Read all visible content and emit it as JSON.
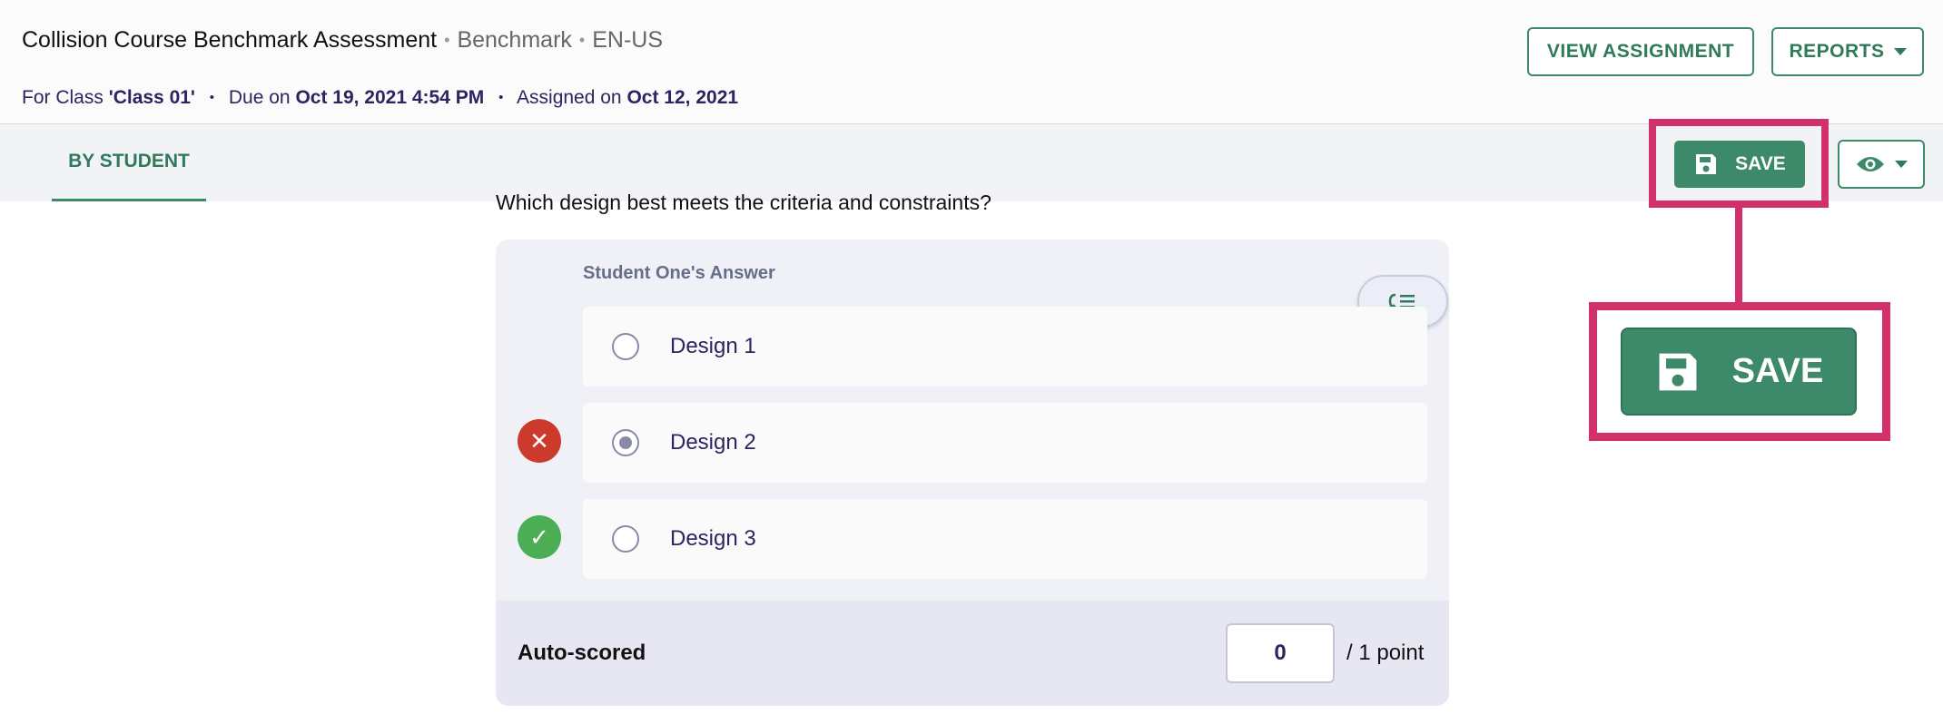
{
  "header": {
    "title": "Collision Course Benchmark Assessment",
    "sep": "•",
    "type": "Benchmark",
    "locale": "EN-US",
    "class_prefix": "For Class",
    "class_name": "'Class 01'",
    "due_prefix": "Due on",
    "due_date": "Oct 19, 2021 4:54 PM",
    "assigned_prefix": "Assigned on",
    "assigned_date": "Oct 12, 2021",
    "view_assignment_label": "VIEW ASSIGNMENT",
    "reports_label": "REPORTS"
  },
  "tabs": [
    {
      "label": "BY STUDENT",
      "active": true
    }
  ],
  "toolbar": {
    "save_label": "SAVE",
    "visibility_icon": "eye-icon"
  },
  "callout": {
    "save_label": "SAVE",
    "highlight_color": "#d1306a"
  },
  "question": {
    "text": "Which design best meets the criteria and constraints?",
    "answer_label": "Student One's Answer",
    "options": [
      {
        "label": "Design 1",
        "selected": false,
        "mark": "none"
      },
      {
        "label": "Design 2",
        "selected": true,
        "mark": "incorrect"
      },
      {
        "label": "Design 3",
        "selected": false,
        "mark": "correct"
      }
    ]
  },
  "scoring": {
    "label": "Auto-scored",
    "value": "0",
    "max_label": "/ 1 point"
  },
  "colors": {
    "accent": "#3d8a6a",
    "text_navy": "#2b2560",
    "incorrect": "#cc3a2b",
    "correct": "#4bae54"
  }
}
